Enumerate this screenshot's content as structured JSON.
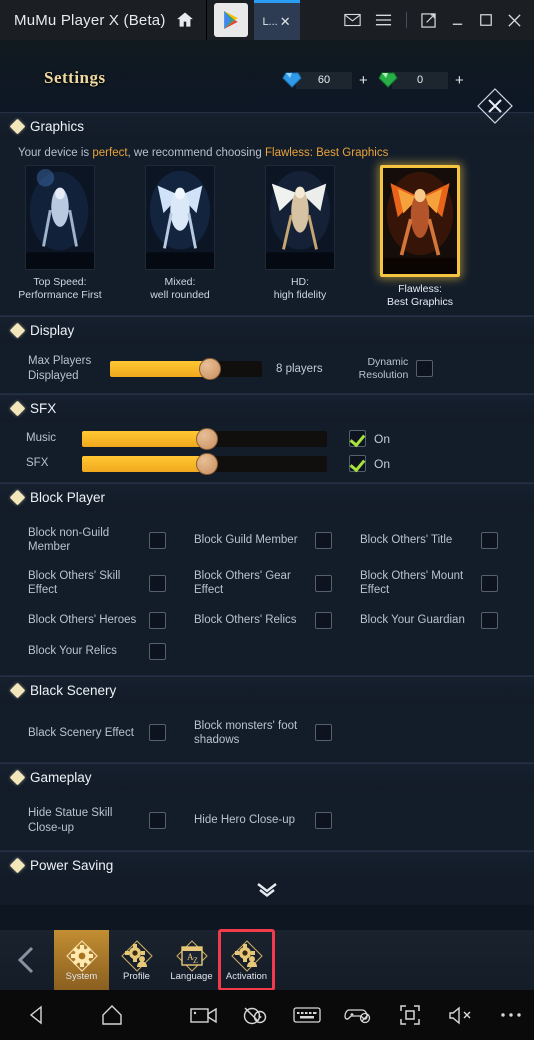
{
  "titlebar": {
    "app_title": "MuMu Player X  (Beta)",
    "home_icon": "home-icon",
    "tabs": [
      {
        "name": "play-store-tab",
        "label": ""
      },
      {
        "name": "game-tab",
        "label": "L...",
        "close": "✕"
      }
    ],
    "right_icons": [
      "mail-icon",
      "menu-icon",
      "multi-window-icon",
      "minimize-icon",
      "maximize-icon",
      "close-icon"
    ]
  },
  "game": {
    "header": {
      "title": "Settings",
      "currency_blue": {
        "icon": "blue-diamond-icon",
        "value": "60",
        "plus": "+"
      },
      "currency_green": {
        "icon": "green-diamond-icon",
        "value": "0",
        "plus": "+"
      },
      "close": "✕"
    },
    "sections": {
      "graphics": {
        "title": "Graphics",
        "recommend_prefix": "Your device is ",
        "recommend_quality": "perfect",
        "recommend_mid": ", we recommend choosing ",
        "recommend_choice": "Flawless: Best Graphics",
        "options": [
          {
            "line1": "Top Speed:",
            "line2": "Performance First",
            "selected": false
          },
          {
            "line1": "Mixed:",
            "line2": "well rounded",
            "selected": false
          },
          {
            "line1": "HD:",
            "line2": "high fidelity",
            "selected": false
          },
          {
            "line1": "Flawless:",
            "line2": "Best Graphics",
            "selected": true
          }
        ]
      },
      "display": {
        "title": "Display",
        "max_players_label_1": "Max Players",
        "max_players_label_2": "Displayed",
        "max_players_value": "8 players",
        "max_players_percent": 66,
        "dynamic_label_1": "Dynamic",
        "dynamic_label_2": "Resolution",
        "dynamic_checked": false
      },
      "sfx": {
        "title": "SFX",
        "rows": [
          {
            "label": "Music",
            "percent": 51,
            "state": "On",
            "checked": true
          },
          {
            "label": "SFX",
            "percent": 51,
            "state": "On",
            "checked": true
          }
        ]
      },
      "block_player": {
        "title": "Block Player",
        "items": [
          {
            "label": "Block non-Guild Member",
            "checked": false
          },
          {
            "label": "Block Guild Member",
            "checked": false
          },
          {
            "label": "Block Others' Title",
            "checked": false
          },
          {
            "label": "Block Others' Skill Effect",
            "checked": false
          },
          {
            "label": "Block Others' Gear Effect",
            "checked": false
          },
          {
            "label": "Block Others' Mount Effect",
            "checked": false
          },
          {
            "label": "Block Others' Heroes",
            "checked": false
          },
          {
            "label": "Block Others' Relics",
            "checked": false
          },
          {
            "label": "Block Your Guardian",
            "checked": false
          },
          {
            "label": "Block Your Relics",
            "checked": false
          }
        ]
      },
      "black_scenery": {
        "title": "Black Scenery",
        "items": [
          {
            "label": "Black Scenery Effect",
            "checked": false
          },
          {
            "label": "Block monsters' foot shadows",
            "checked": false
          }
        ]
      },
      "gameplay": {
        "title": "Gameplay",
        "items": [
          {
            "label": "Hide Statue Skill Close-up",
            "checked": false
          },
          {
            "label": "Hide Hero Close-up",
            "checked": false
          }
        ]
      },
      "power_saving": {
        "title": "Power Saving",
        "chevron": "chevron-double-down-icon"
      }
    },
    "bottom_tabs": {
      "back": "‹",
      "items": [
        {
          "label": "System",
          "icon": "gear-icon",
          "active": true,
          "highlight": false
        },
        {
          "label": "Profile",
          "icon": "gear-person-icon",
          "active": false,
          "highlight": false
        },
        {
          "label": "Language",
          "icon": "language-az-icon",
          "active": false,
          "highlight": false
        },
        {
          "label": "Activation",
          "icon": "gear-person-icon",
          "active": false,
          "highlight": true
        }
      ]
    }
  },
  "navbar": {
    "icons": [
      "back-icon",
      "home-icon",
      "record-icon",
      "screenshot-icon",
      "keyboard-icon",
      "gamepad-disabled-icon",
      "fullscreen-icon",
      "mute-icon",
      "more-icon"
    ]
  },
  "colors": {
    "accent_gold": "#f5c542",
    "title_gold": "#f0d9a0",
    "highlight_red": "#f23b4a",
    "check_green": "#a6e33c",
    "panel_bg": "#131d2a"
  }
}
